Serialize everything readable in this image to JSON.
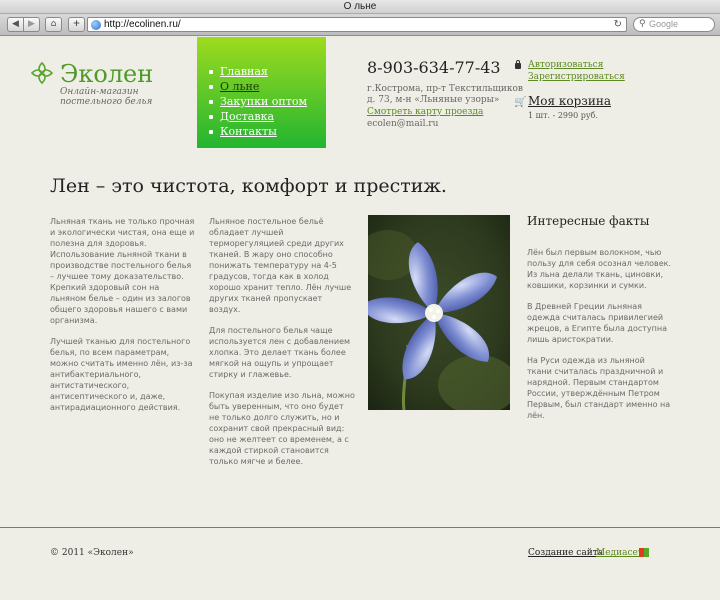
{
  "browser": {
    "title": "О льне",
    "url": "http://ecolinen.ru/",
    "search_placeholder": "Google"
  },
  "header": {
    "logo_name": "Эколен",
    "logo_subtitle_1": "Онлайн-магазин",
    "logo_subtitle_2": "постельного белья",
    "menu": [
      {
        "label": "Главная"
      },
      {
        "label": "О льне"
      },
      {
        "label": "Закупки оптом"
      },
      {
        "label": "Доставка"
      },
      {
        "label": "Контакты"
      }
    ],
    "phone": "8-903-634-77-43",
    "address_1": "г.Кострома, пр-т Текстильщиков",
    "address_2": "д. 73, м-н «Льняные узоры»",
    "map_link": "Смотреть карту проезда",
    "email": "ecolen@mail.ru",
    "login": "Авторизоваться",
    "register": "Зарегистрироваться",
    "cart_title": "Моя корзина",
    "cart_info": "1 шт. - 2990 руб."
  },
  "main": {
    "headline": "Лен – это чистота, комфорт и престиж.",
    "col1": [
      "Льняная ткань не только прочная и экологически чистая, она еще и полезна для здоровья. Использование льняной ткани в производстве постельного белья – лучшее тому доказательство. Крепкий здоровый сон на льняном белье – один из залогов общего здоровья нашего с вами организма.",
      "Лучшей тканью для постельного белья, по всем параметрам, можно считать именно лён, из-за антибактериального, антистатического, антисептического и, даже, антирадиационного действия."
    ],
    "col2": [
      "Льняное постельное бельё обладает лучшей терморегуляцией среди других тканей. В жару оно способно понижать температуру на 4-5 градусов, тогда как в холод хорошо хранит тепло. Лён лучше других тканей пропускает воздух.",
      "Для постельного белья чаще используется лен с добавлением хлопка. Это делает ткань более мягкой на ощупь и упрощает стирку и глажевье.",
      "Покупая изделие изо льна, можно быть уверенным, что оно будет не только долго служить, но и сохранит свой прекрасный вид: оно не желтеет со временем, а с каждой стиркой становится только мягче и белее."
    ],
    "facts_title": "Интересные факты",
    "facts": [
      "Лён был первым волокном, чью пользу для себя осознал человек. Из льна делали ткань, циновки, ковшики, корзинки и сумки.",
      "В Древней Греции льняная одежда считалась привилегией жрецов, а Египте была доступна лишь аристократии.",
      "На Руси одежда из льняной ткани считалась праздничной и нарядной. Первым стандартом России, утверждённым Петром Первым, был стандарт именно на лён."
    ]
  },
  "footer": {
    "copyright": "© 2011 «Эколен»",
    "site_link": "Создание сайта",
    "separator": "-",
    "media_link": "Медиасеть"
  }
}
